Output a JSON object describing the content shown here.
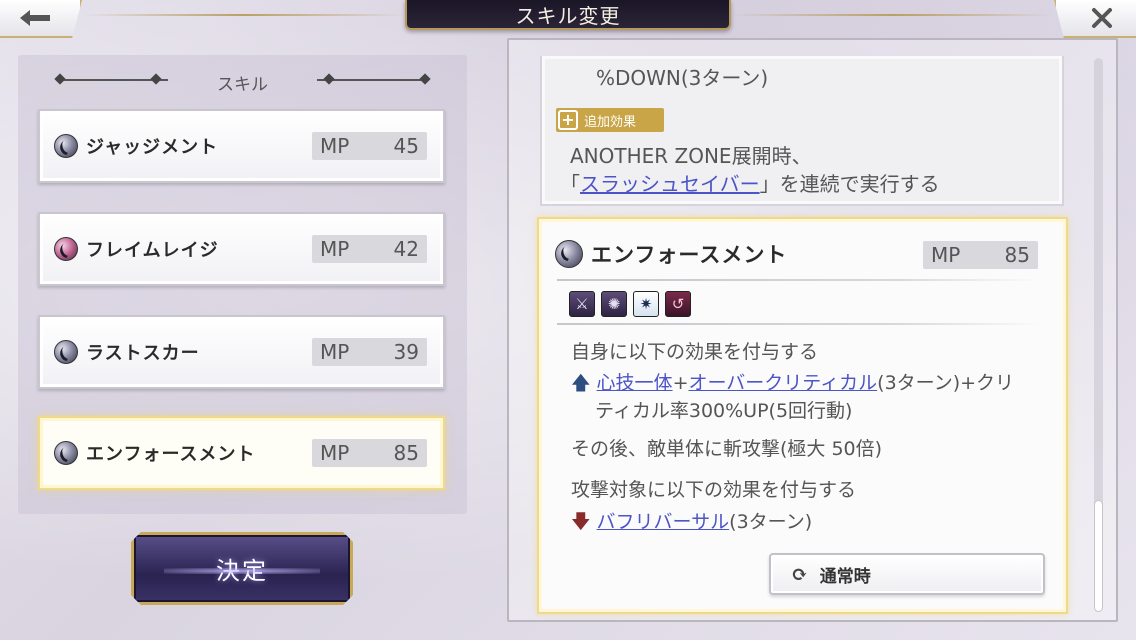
{
  "header": {
    "title": "スキル変更",
    "back_icon": "arrow-left-icon",
    "close_icon": "close-icon"
  },
  "left": {
    "section_title": "スキル",
    "skills": [
      {
        "name": "ジャッジメント",
        "mp_label": "MP",
        "mp": "45",
        "icon": "slash-orb-icon"
      },
      {
        "name": "フレイムレイジ",
        "mp_label": "MP",
        "mp": "42",
        "icon": "flame-orb-icon"
      },
      {
        "name": "ラストスカー",
        "mp_label": "MP",
        "mp": "39",
        "icon": "slash-orb-icon"
      },
      {
        "name": "エンフォースメント",
        "mp_label": "MP",
        "mp": "85",
        "icon": "slash-orb-icon",
        "selected": true
      }
    ],
    "decide_label": "決定"
  },
  "detail_top": {
    "line1": "%DOWN(3ターン)",
    "tag_label": "追加効果",
    "line2": "ANOTHER ZONE展開時、",
    "line3_prefix": "「",
    "line3_link": "スラッシュセイバー",
    "line3_suffix": "」を連続で実行する"
  },
  "detail_main": {
    "title": "エンフォースメント",
    "mp_label": "MP",
    "mp": "85",
    "badge_icons": [
      "slash-attack-icon",
      "gear-buff-icon",
      "critical-burst-icon",
      "reversal-icon"
    ],
    "desc1": "自身に以下の効果を付与する",
    "buff_link1": "心技一体",
    "buff_plus": "+",
    "buff_link2": "オーバークリティカル",
    "buff_rest": "(3ターン)+クリ",
    "buff_line2": "ティカル率300%UP(5回行動)",
    "desc2": "その後、敵単体に斬攻撃(極大 50倍)",
    "desc3": "攻撃対象に以下の効果を付与する",
    "debuff_link": "バフリバーサル",
    "debuff_rest": "(3ターン)",
    "normal_label": "通常時"
  },
  "colors": {
    "accent_gold": "#efd98a",
    "link_blue": "#4c54c8",
    "title_plate": "#1a1626"
  }
}
